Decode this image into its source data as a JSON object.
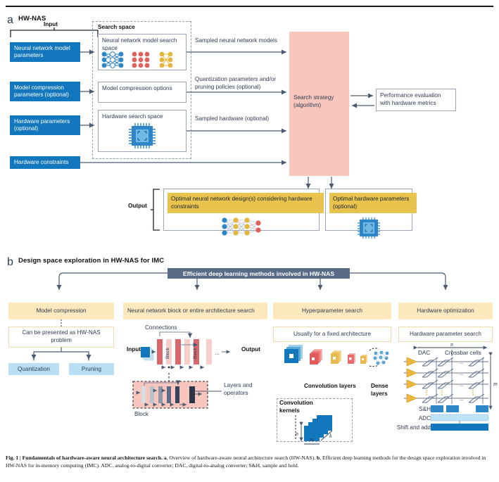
{
  "panel_a": {
    "letter": "a",
    "title": "HW-NAS",
    "input_label": "Input",
    "output_label": "Output",
    "inputs": [
      "Neural network model parameters",
      "Model compression parameters (optional)",
      "Hardware parameters (optional)",
      "Hardware constraints"
    ],
    "search_space_title": "Search space",
    "search_space_boxes": [
      "Neural network model search space",
      "Model compression options",
      "Hardware search space"
    ],
    "edge_labels": [
      "Sampled neural network models",
      "Quantization parameters and/or pruning policies (optional)",
      "Sampled hardware (optional)"
    ],
    "search_strategy": "Search strategy (algorithm)",
    "performance_eval": "Performance evaluation with hardware metrics",
    "outputs": [
      "Optimal neural network design(s) considering hardware constraints",
      "Optimal hardware parameters (optional)"
    ]
  },
  "panel_b": {
    "letter": "b",
    "title": "Design space exploration in HW-NAS for IMC",
    "header_bar": "Efficient deep learning methods involved in HW-NAS",
    "columns": [
      {
        "head": "Model compression",
        "sub": "Can be presented as HW-NAS problem",
        "leaves": [
          "Quantization",
          "Pruning"
        ]
      },
      {
        "head": "Neural network block or entire architecture search",
        "diagram": {
          "connections_label": "Connections",
          "input_label": "Input",
          "output_label": "Output",
          "block_label": "Block",
          "ellipsis": "...",
          "detail_block_label": "Block",
          "layers_label": "Layers and operators"
        }
      },
      {
        "head": "Hyperparameter search",
        "sub": "Usually for a fixed architecture",
        "diagram": {
          "conv_label": "Convolution layers",
          "dense_label": "Dense layers",
          "kernels_title": "Convolution kernels",
          "dim_n": "n",
          "dim_m": "m",
          "dim_k": "k"
        }
      },
      {
        "head": "Hardware optimization",
        "sub": "Hardware parameter search",
        "diagram": {
          "dac_label": "DAC",
          "crossbar_label": "Crossbar cells",
          "dim_n": "n",
          "dim_m": "m",
          "sh_label": "S&H",
          "adc_label": "ADC",
          "shift_label": "Shift and add",
          "ellipsis": "..."
        }
      }
    ]
  },
  "caption": {
    "fig_no": "Fig. 1 | ",
    "bold_title": "Fundamentals of hardware-aware neural architecture search.",
    "a_bold": " a",
    "a_text": ", Overview of hardware-aware neural architecture search (HW-NAS).",
    "b_bold": " b",
    "b_text": ", Efficient deep learning methods for the design space exploration involved in HW-NAS for in-memory computing (IMC). ADC, analog-to-digital converter; DAC, digital-to-analog converter; S&H, sample and hold."
  },
  "colors": {
    "blue": "#1277bc",
    "pink": "#f8c6bd",
    "yellow": "#e8c34d",
    "cream": "#fce8bd",
    "light_blue": "#b9e0f2",
    "slate": "#5a6b87",
    "arrow": "#4a5a72",
    "red": "#d9534f",
    "gold": "#e3b63c"
  }
}
